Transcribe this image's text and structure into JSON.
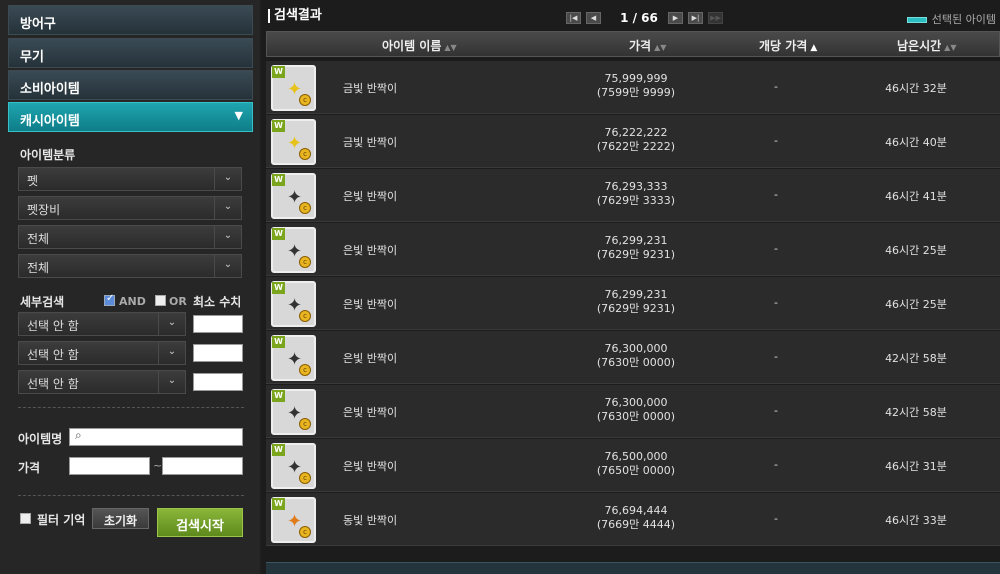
{
  "sidebar": {
    "categories": [
      {
        "label": "방어구"
      },
      {
        "label": "무기"
      },
      {
        "label": "소비아이템"
      },
      {
        "label": "캐시아이템"
      }
    ],
    "classification_label": "아이템분류",
    "selects": [
      "펫",
      "펫장비",
      "전체",
      "전체"
    ],
    "detail_label": "세부검색",
    "and_label": "AND",
    "or_label": "OR",
    "min_value_label": "최소 수치",
    "detail_selects": [
      "선택 안 함",
      "선택 안 함",
      "선택 안 함"
    ],
    "item_name_label": "아이템명",
    "item_name_value": "",
    "price_label": "가격",
    "price_separator": "~",
    "filter_memory_label": "필터 기억",
    "reset_label": "초기화",
    "search_label": "검색시작"
  },
  "main": {
    "title": "검색결과",
    "page_text": "1 / 66",
    "selected_legend": "선택된 아이템",
    "headers": {
      "name": "아이템 이름",
      "price": "가격",
      "unit_price": "개당 가격",
      "remaining": "남은시간"
    },
    "rows": [
      {
        "name": "금빛 반짝이",
        "price": "75,999,999",
        "price_sub": "(7599만 9999)",
        "unit": "-",
        "time": "46시간 32분",
        "gem": "gold"
      },
      {
        "name": "금빛 반짝이",
        "price": "76,222,222",
        "price_sub": "(7622만 2222)",
        "unit": "-",
        "time": "46시간 40분",
        "gem": "gold"
      },
      {
        "name": "은빛 반짝이",
        "price": "76,293,333",
        "price_sub": "(7629만 3333)",
        "unit": "-",
        "time": "46시간 41분",
        "gem": "silver"
      },
      {
        "name": "은빛 반짝이",
        "price": "76,299,231",
        "price_sub": "(7629만 9231)",
        "unit": "-",
        "time": "46시간 25분",
        "gem": "silver"
      },
      {
        "name": "은빛 반짝이",
        "price": "76,299,231",
        "price_sub": "(7629만 9231)",
        "unit": "-",
        "time": "46시간 25분",
        "gem": "silver"
      },
      {
        "name": "은빛 반짝이",
        "price": "76,300,000",
        "price_sub": "(7630만 0000)",
        "unit": "-",
        "time": "42시간 58분",
        "gem": "silver"
      },
      {
        "name": "은빛 반짝이",
        "price": "76,300,000",
        "price_sub": "(7630만 0000)",
        "unit": "-",
        "time": "42시간 58분",
        "gem": "silver"
      },
      {
        "name": "은빛 반짝이",
        "price": "76,500,000",
        "price_sub": "(7650만 0000)",
        "unit": "-",
        "time": "46시간 31분",
        "gem": "silver"
      },
      {
        "name": "동빛 반짝이",
        "price": "76,694,444",
        "price_sub": "(7669만 4444)",
        "unit": "-",
        "time": "46시간 33분",
        "gem": "bronze"
      }
    ]
  },
  "colors": {
    "accent": "#1fa5b0",
    "search_button": "#8ab63a",
    "gold": "#e8c21a",
    "silver": "#333333",
    "bronze": "#e07a1a"
  }
}
